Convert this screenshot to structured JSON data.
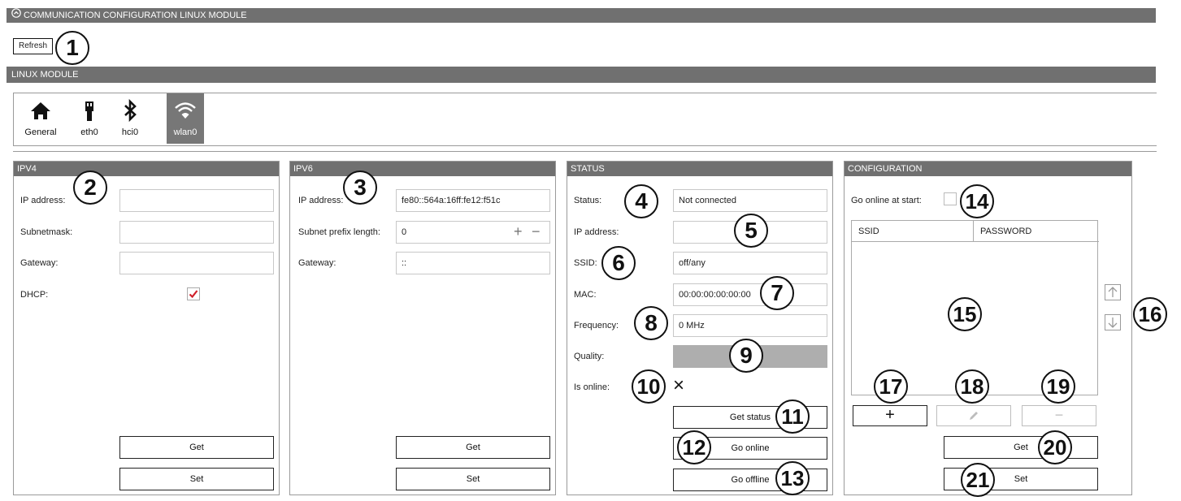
{
  "header": {
    "title": "COMMUNICATION CONFIGURATION LINUX MODULE"
  },
  "toolbar": {
    "refresh_label": "Refresh"
  },
  "module": {
    "title": "LINUX MODULE",
    "tabs": [
      {
        "label": "General",
        "icon": "home-icon"
      },
      {
        "label": "eth0",
        "icon": "ethernet-plug-icon"
      },
      {
        "label": "hci0",
        "icon": "bluetooth-icon"
      },
      {
        "label": "wlan0",
        "icon": "wifi-icon",
        "selected": true
      }
    ]
  },
  "ipv4": {
    "title": "IPV4",
    "ip_label": "IP address:",
    "ip_value": "",
    "subnet_label": "Subnetmask:",
    "subnet_value": "",
    "gateway_label": "Gateway:",
    "gateway_value": "",
    "dhcp_label": "DHCP:",
    "dhcp_checked": true,
    "get_label": "Get",
    "set_label": "Set"
  },
  "ipv6": {
    "title": "IPV6",
    "ip_label": "IP address:",
    "ip_value": "fe80::564a:16ff:fe12:f51c",
    "prefix_label": "Subnet prefix length:",
    "prefix_value": "0",
    "gateway_label": "Gateway:",
    "gateway_value": "::",
    "get_label": "Get",
    "set_label": "Set"
  },
  "status": {
    "title": "STATUS",
    "status_label": "Status:",
    "status_value": "Not connected",
    "ip_label": "IP address:",
    "ip_value": "",
    "ssid_label": "SSID:",
    "ssid_value": "off/any",
    "mac_label": "MAC:",
    "mac_value": "00:00:00:00:00:00",
    "freq_label": "Frequency:",
    "freq_value": "0 MHz",
    "quality_label": "Quality:",
    "quality_value": 0,
    "online_label": "Is online:",
    "online_value": "×",
    "get_status_label": "Get status",
    "go_online_label": "Go online",
    "go_offline_label": "Go offline"
  },
  "configuration": {
    "title": "CONFIGURATION",
    "go_online_start_label": "Go online at start:",
    "go_online_start_checked": false,
    "columns": [
      "SSID",
      "PASSWORD"
    ],
    "rows": [],
    "get_label": "Get",
    "set_label": "Set"
  },
  "callouts": [
    "1",
    "2",
    "3",
    "4",
    "5",
    "6",
    "7",
    "8",
    "9",
    "10",
    "11",
    "12",
    "13",
    "14",
    "15",
    "16",
    "17",
    "18",
    "19",
    "20",
    "21"
  ]
}
